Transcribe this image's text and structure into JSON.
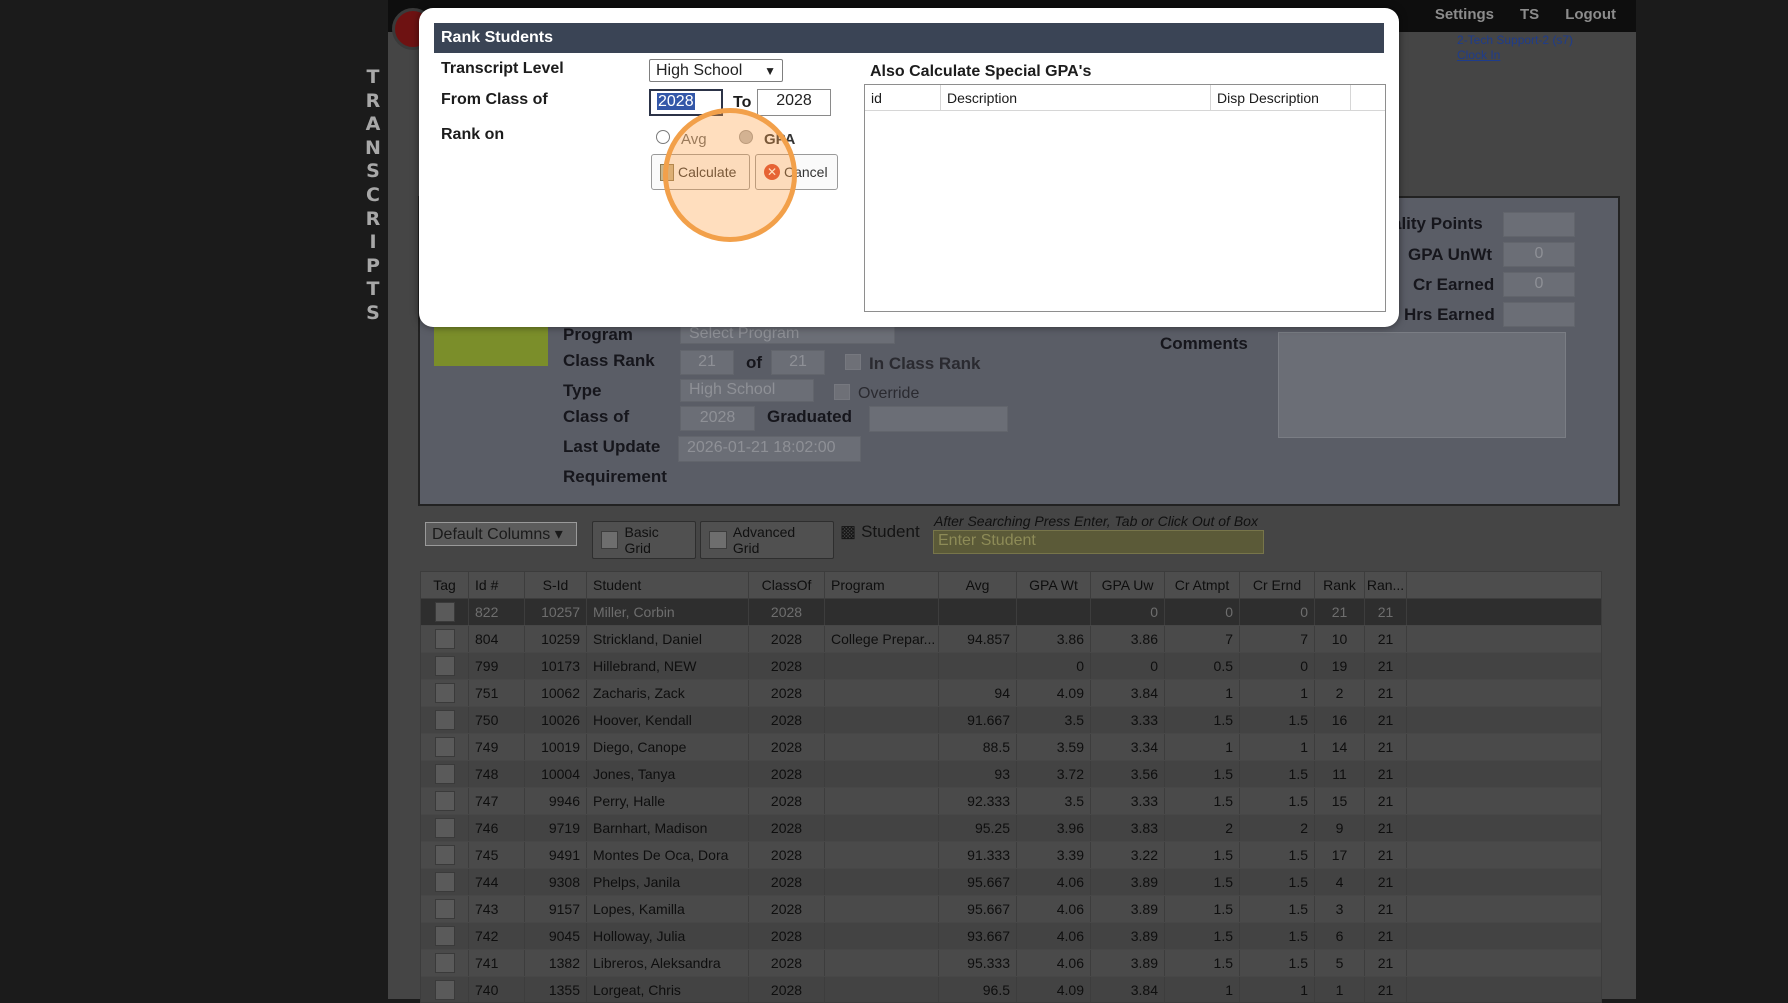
{
  "side_label": [
    "T",
    "R",
    "A",
    "N",
    "S",
    "C",
    "R",
    "I",
    "P",
    "T",
    "S"
  ],
  "topnav": [
    "Settings",
    "TS",
    "Logout"
  ],
  "user": {
    "name": "2-Tech Support-2 (s7)",
    "clock": "Clock In"
  },
  "detail": {
    "quality_points": "ality Points",
    "gpa_unwt": "GPA UnWt",
    "gpa_unwt_val": "0",
    "cr_earned": "Cr Earned",
    "cr_earned_val": "0",
    "hrs_earned": "Hrs Earned",
    "program_lbl": "Program",
    "program_val": "Select Program",
    "class_rank_lbl": "Class Rank",
    "rank_val": "21",
    "of": "of",
    "rank_of_val": "21",
    "in_class_rank": "In Class Rank",
    "type_lbl": "Type",
    "type_val": "High School",
    "override": "Override",
    "class_of_lbl": "Class of",
    "class_of_val": "2028",
    "graduated_lbl": "Graduated",
    "last_update_lbl": "Last Update",
    "last_update_val": "2026-01-21 18:02:00",
    "requirement_lbl": "Requirement",
    "comments_lbl": "Comments"
  },
  "toolbar": {
    "columns": "Default Columns",
    "basic_grid": "Basic Grid",
    "advanced_grid": "Advanced Grid",
    "student": "Student",
    "hint": "After Searching Press Enter, Tab or Click Out of Box",
    "enter_placeholder": "Enter Student"
  },
  "grid": {
    "headers": [
      "Tag",
      "Id #",
      "S-Id",
      "Student",
      "ClassOf",
      "Program",
      "Avg",
      "GPA Wt",
      "GPA Uw",
      "Cr Atmpt",
      "Cr Ernd",
      "Rank",
      "Ran..."
    ],
    "rows": [
      [
        "",
        "822",
        "10257",
        "Miller, Corbin",
        "2028",
        "",
        "",
        "",
        "0",
        "0",
        "0",
        "21",
        "21"
      ],
      [
        "",
        "804",
        "10259",
        "Strickland, Daniel",
        "2028",
        "College Prepar...",
        "94.857",
        "3.86",
        "3.86",
        "7",
        "7",
        "10",
        "21"
      ],
      [
        "",
        "799",
        "10173",
        "Hillebrand, NEW",
        "2028",
        "",
        "",
        "0",
        "0",
        "0.5",
        "0",
        "19",
        "21"
      ],
      [
        "",
        "751",
        "10062",
        "Zacharis, Zack",
        "2028",
        "",
        "94",
        "4.09",
        "3.84",
        "1",
        "1",
        "2",
        "21"
      ],
      [
        "",
        "750",
        "10026",
        "Hoover, Kendall",
        "2028",
        "",
        "91.667",
        "3.5",
        "3.33",
        "1.5",
        "1.5",
        "16",
        "21"
      ],
      [
        "",
        "749",
        "10019",
        "Diego, Canope",
        "2028",
        "",
        "88.5",
        "3.59",
        "3.34",
        "1",
        "1",
        "14",
        "21"
      ],
      [
        "",
        "748",
        "10004",
        "Jones, Tanya",
        "2028",
        "",
        "93",
        "3.72",
        "3.56",
        "1.5",
        "1.5",
        "11",
        "21"
      ],
      [
        "",
        "747",
        "9946",
        "Perry, Halle",
        "2028",
        "",
        "92.333",
        "3.5",
        "3.33",
        "1.5",
        "1.5",
        "15",
        "21"
      ],
      [
        "",
        "746",
        "9719",
        "Barnhart, Madison",
        "2028",
        "",
        "95.25",
        "3.96",
        "3.83",
        "2",
        "2",
        "9",
        "21"
      ],
      [
        "",
        "745",
        "9491",
        "Montes De Oca, Dora",
        "2028",
        "",
        "91.333",
        "3.39",
        "3.22",
        "1.5",
        "1.5",
        "17",
        "21"
      ],
      [
        "",
        "744",
        "9308",
        "Phelps, Janila",
        "2028",
        "",
        "95.667",
        "4.06",
        "3.89",
        "1.5",
        "1.5",
        "4",
        "21"
      ],
      [
        "",
        "743",
        "9157",
        "Lopes, Kamilla",
        "2028",
        "",
        "95.667",
        "4.06",
        "3.89",
        "1.5",
        "1.5",
        "3",
        "21"
      ],
      [
        "",
        "742",
        "9045",
        "Holloway, Julia",
        "2028",
        "",
        "93.667",
        "4.06",
        "3.89",
        "1.5",
        "1.5",
        "6",
        "21"
      ],
      [
        "",
        "741",
        "1382",
        "Libreros, Aleksandra",
        "2028",
        "",
        "95.333",
        "4.06",
        "3.89",
        "1.5",
        "1.5",
        "5",
        "21"
      ],
      [
        "",
        "740",
        "1355",
        "Lorgeat, Chris",
        "2028",
        "",
        "96.5",
        "4.09",
        "3.84",
        "1",
        "1",
        "1",
        "21"
      ]
    ]
  },
  "modal": {
    "title": "Rank Students",
    "transcript_level_lbl": "Transcript Level",
    "transcript_level_val": "High School",
    "from_class_lbl": "From Class of",
    "from_val": "2028",
    "to_lbl": "To",
    "to_val": "2028",
    "rank_on_lbl": "Rank on",
    "avg": "Avg",
    "gpa": "GPA",
    "calculate": "Calculate",
    "cancel": "Cancel",
    "special_title": "Also Calculate Special GPA's",
    "special_headers": [
      "id",
      "Description",
      "Disp Description"
    ]
  },
  "colors": {
    "modal_title_bg": "#3a4455",
    "highlight": "#f2a04a"
  }
}
